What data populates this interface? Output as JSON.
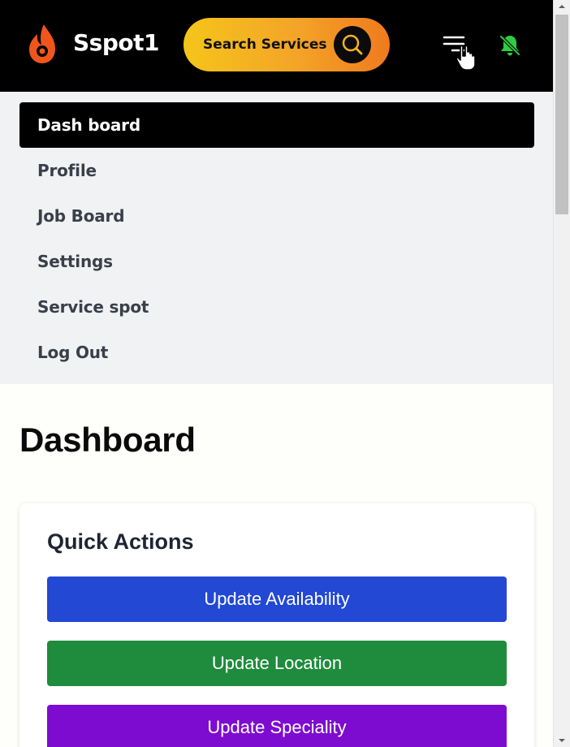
{
  "header": {
    "brand_name": "Sspot1",
    "search_label": "Search Services",
    "icons": {
      "logo": "flame-logo-icon",
      "search": "search-icon",
      "menu": "hamburger-menu-icon",
      "notifications": "bell-off-icon"
    },
    "colors": {
      "background": "#000000",
      "search_gradient_start": "#f5c51a",
      "search_gradient_end": "#ef7a1e",
      "logo": "#f0561c",
      "bell": "#2ecc40"
    }
  },
  "menu": {
    "items": [
      {
        "label": "Dash board",
        "active": true
      },
      {
        "label": "Profile",
        "active": false
      },
      {
        "label": "Job Board",
        "active": false
      },
      {
        "label": "Settings",
        "active": false
      },
      {
        "label": "Service spot",
        "active": false
      },
      {
        "label": "Log Out",
        "active": false
      }
    ]
  },
  "main": {
    "title": "Dashboard",
    "quick_actions": {
      "title": "Quick Actions",
      "buttons": [
        {
          "label": "Update Availability",
          "color": "#2248d4"
        },
        {
          "label": "Update Location",
          "color": "#1e8c3c"
        },
        {
          "label": "Update Speciality",
          "color": "#7e0cd0"
        }
      ]
    }
  }
}
